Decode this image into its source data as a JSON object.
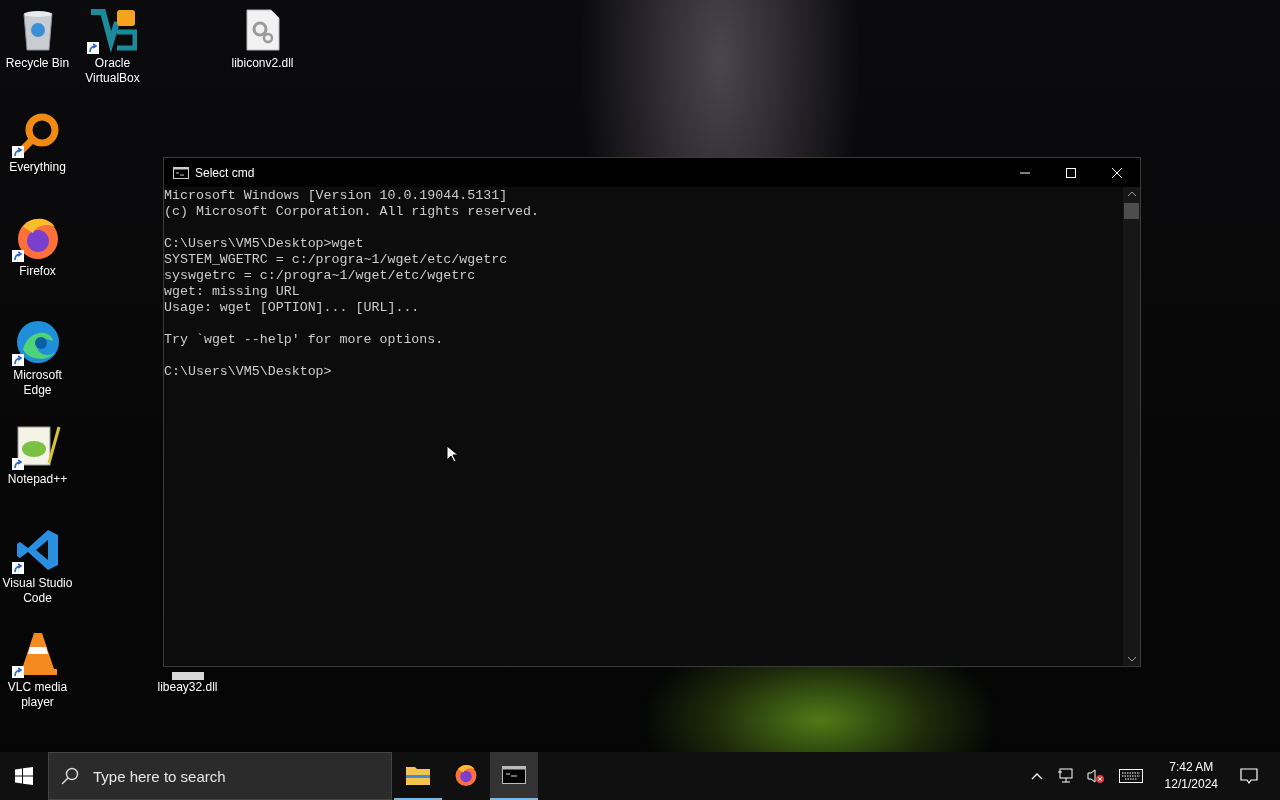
{
  "desktop_icons": [
    {
      "label": "Recycle Bin",
      "kind": "recycle-bin",
      "shortcut": false
    },
    {
      "label": "Oracle VirtualBox",
      "kind": "virtualbox",
      "shortcut": true
    },
    {
      "label": "libiconv2.dll",
      "kind": "dll",
      "shortcut": false
    },
    {
      "label": "Everything",
      "kind": "everything",
      "shortcut": true
    },
    {
      "label": "Firefox",
      "kind": "firefox",
      "shortcut": true
    },
    {
      "label": "Microsoft Edge",
      "kind": "edge",
      "shortcut": true
    },
    {
      "label": "Notepad++",
      "kind": "notepad",
      "shortcut": true
    },
    {
      "label": "Visual Studio Code",
      "kind": "vscode",
      "shortcut": true
    },
    {
      "label": "VLC media player",
      "kind": "vlc",
      "shortcut": true
    },
    {
      "label": "libeay32.dll",
      "kind": "dll-hidden",
      "shortcut": false
    }
  ],
  "console_window": {
    "title": "Select cmd",
    "blocks": [
      [
        "Microsoft Windows [Version 10.0.19044.5131]",
        "(c) Microsoft Corporation. All rights reserved."
      ],
      [
        "C:\\Users\\VM5\\Desktop>wget",
        "SYSTEM_WGETRC = c:/progra~1/wget/etc/wgetrc",
        "syswgetrc = c:/progra~1/wget/etc/wgetrc",
        "wget: missing URL",
        "Usage: wget [OPTION]... [URL]..."
      ],
      [
        "Try `wget --help' for more options."
      ],
      [
        "C:\\Users\\VM5\\Desktop>"
      ]
    ]
  },
  "taskbar": {
    "search": {
      "placeholder": "Type here to search"
    },
    "apps": [
      {
        "kind": "explorer",
        "running": true,
        "selected": false
      },
      {
        "kind": "firefox",
        "running": false,
        "selected": false
      },
      {
        "kind": "cmd",
        "running": true,
        "selected": true
      }
    ],
    "clock": {
      "time": "7:42 AM",
      "date": "12/1/2024"
    }
  }
}
